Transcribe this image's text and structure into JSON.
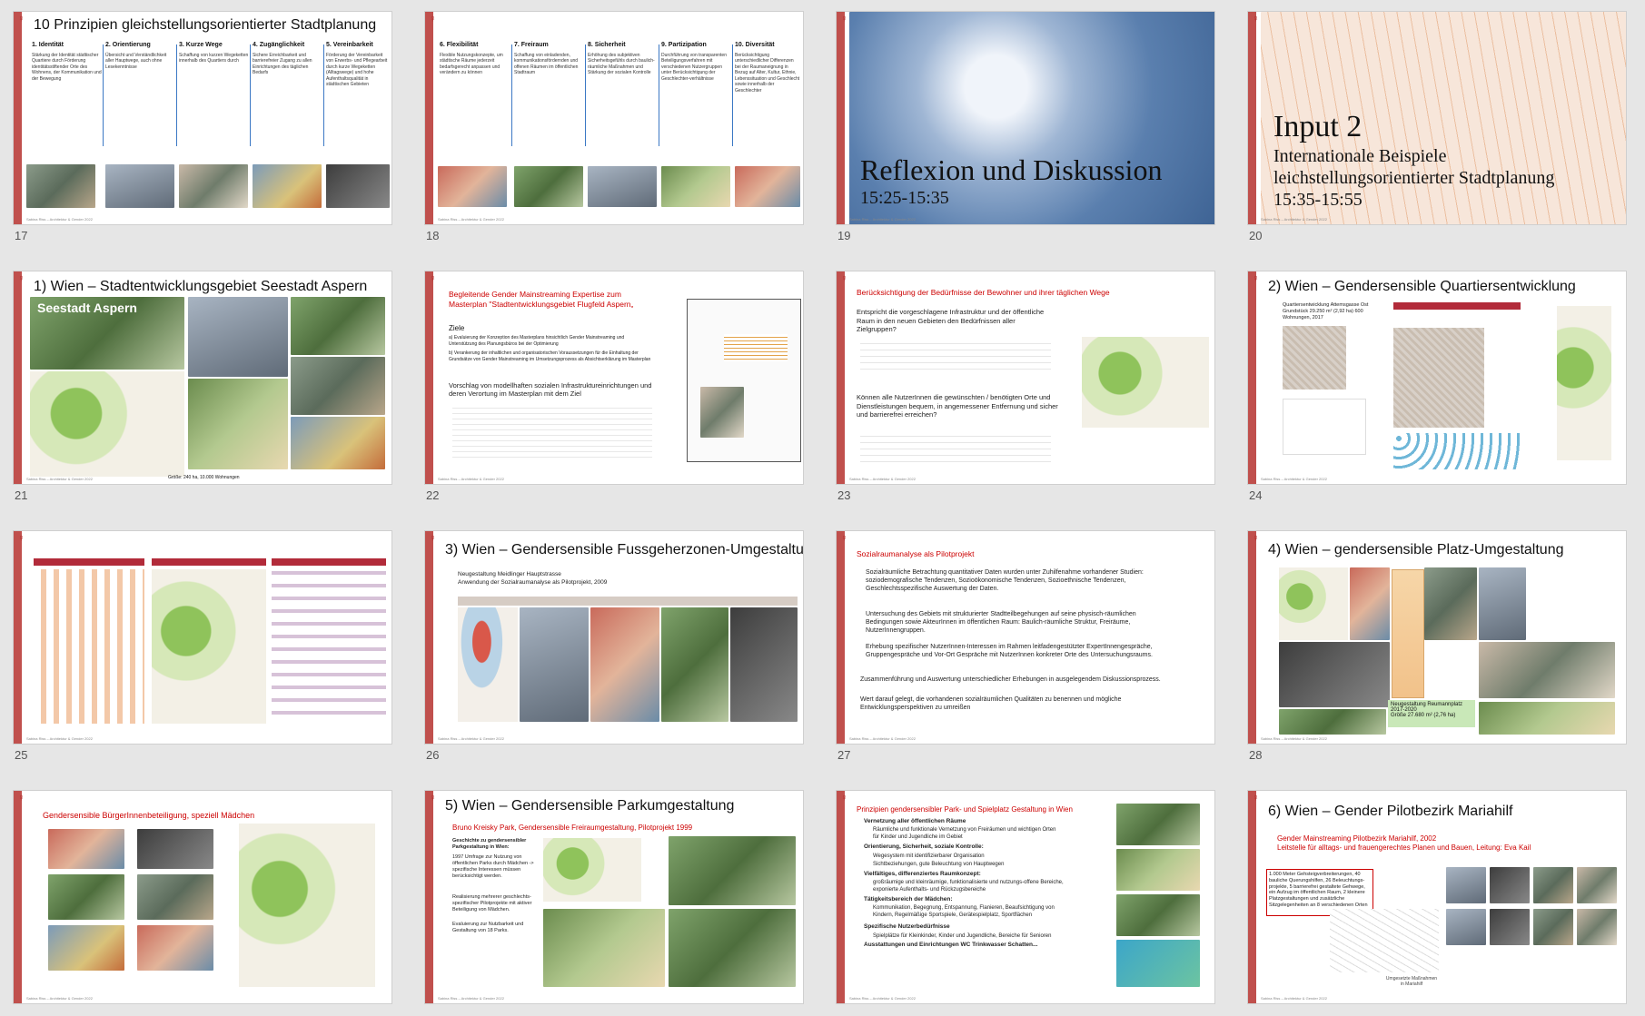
{
  "slides": [
    {
      "num": "17",
      "title": "10 Prinzipien gleichstellungsorientierter Stadtplanung",
      "cols": [
        {
          "head": "1. Identität",
          "text": "Stärkung der Identität städtischer Quartiere durch Förderung identitätsstiftender Orte des Wohnens, der Kommunikation und der Bewegung"
        },
        {
          "head": "2. Orientierung",
          "text": "Übersicht und Verständlichkeit aller Hauptwege, auch ohne Lesekenntnisse"
        },
        {
          "head": "3. Kurze Wege",
          "text": "Schaffung von kurzen Wegeketten innerhalb des Quartiers durch"
        },
        {
          "head": "4. Zugänglichkeit",
          "text": "Sichere Erreichbarkeit und barrierefreier Zugang zu allen Einrichtungen des täglichen Bedarfs"
        },
        {
          "head": "5. Vereinbarkeit",
          "text": "Förderung der Vereinbarkeit von Erwerbs- und Pflegearbeit durch kurze Wegeketten (Alltagswege) und hohe Aufenthaltsqualität in städtischen Gebieten"
        }
      ]
    },
    {
      "num": "18",
      "cols": [
        {
          "head": "6. Flexibilität",
          "text": "Flexible Nutzungskonzepte, um städtische Räume jederzeit bedarfsgerecht anpassen und verändern zu können"
        },
        {
          "head": "7. Freiraum",
          "text": "Schaffung von einladenden, kommunikationsfördernden und offenen Räumen im öffentlichen Stadtraum"
        },
        {
          "head": "8. Sicherheit",
          "text": "Erhöhung des subjektiven Sicherheitsgefühls durch baulich-räumliche Maßnahmen und Stärkung der sozialen Kontrolle"
        },
        {
          "head": "9. Partizipation",
          "text": "Durchführung von transparenten Beteiligungsverfahren mit verschiedenen Nutzergruppen unter Berücksichtigung der Geschlechter-verhältnisse"
        },
        {
          "head": "10. Diversität",
          "text": "Berücksichtigung unterschiedlicher Differenzen bei der Raumaneignung in Bezug auf Alter, Kultur, Ethnie, Lebenssituation und Geschlecht sowie innerhalb der Geschlechter"
        }
      ]
    },
    {
      "num": "19",
      "title": "Reflexion und Diskussion",
      "sub": "15:25-15:35"
    },
    {
      "num": "20",
      "title": "Input 2",
      "l1": "Internationale Beispiele",
      "l2": "leichstellungsorientierter Stadtplanung",
      "l3": "15:35-15:55"
    },
    {
      "num": "21",
      "title": "1) Wien – Stadtentwicklungsgebiet Seestadt Aspern",
      "overlay": "Seestadt Aspern",
      "caption": "Größe: 240 ha, 10.000 Wohnungen"
    },
    {
      "num": "22",
      "title": "Begleitende Gender Mainstreaming Expertise zum Masterplan \"Stadtentwicklungsgebiet Flugfeld Aspern„",
      "ziele": "Ziele",
      "a": "Evaluierung der Konzeption des Masterplans hinsichtlich Gender Mainstreaming und Unterstützung des Planungsbüros bei der Optimierung",
      "b": "Verankerung der inhaltlichen und organisatorischen Voraussetzungen für die Einhaltung der Grundsätze von Gender Mainstreaming im Umsetzungsprozess als Absichtserklärung im Masterplan",
      "vorschlag": "Vorschlag von modellhaften sozialen Infrastruktureinrichtungen und deren Verortung im Masterplan mit dem Ziel"
    },
    {
      "num": "23",
      "title": "Berücksichtigung der Bedürfnisse der Bewohner und ihrer täglichen Wege",
      "t1": "Entspricht die vorgeschlagene Infrastruktur und der öffentliche Raum in den neuen Gebieten den Bedürfnissen aller Zielgruppen?",
      "t2": "Können alle NutzerInnen die gewünschten / benötigten Orte und Dienstleistungen bequem, in angemessener Entfernung und sicher und barrierefrei erreichen?"
    },
    {
      "num": "24",
      "title": "2) Wien – Gendersensible Quartiersentwicklung",
      "info": "Quartiersentwicklung Attemsgasse Ost Grundstück 29.250 m² (2,92 ha) 600 Wohnungen, 2017"
    },
    {
      "num": "25"
    },
    {
      "num": "26",
      "title": "3) Wien – Gendersensible Fussgeherzonen-Umgestaltung",
      "sub1": "Neugestaltung Meidlinger Hauptstrasse",
      "sub2": "Anwendung der Sozialraumanalyse als Pilotprojekt, 2009"
    },
    {
      "num": "27",
      "title": "Sozialraumanalyse als Pilotprojekt",
      "b1": "Sozialräumliche Betrachtung quantitativer Daten wurden unter Zuhilfenahme vorhandener Studien: soziodemografische Tendenzen, Sozioökonomische Tendenzen, Sozioethnische Tendenzen, Geschlechtsspezifische Auswertung der Daten.",
      "b2": "Untersuchung des Gebiets mit strukturierter Stadtteilbegehungen auf seine physisch-räumlichen Bedingungen sowie AkteurInnen im öffentlichen Raum: Baulich-räumliche Struktur, Freiräume, NutzerInnengruppen.",
      "b3": "Erhebung spezifischer NutzerInnen-Interessen im Rahmen leitfadengestützter ExpertInnengespräche, Gruppengespräche und Vor-Ort Gespräche mit NutzerInnen konkreter Orte des Untersuchungsraums.",
      "p1": "Zusammenführung und Auswertung unterschiedlicher Erhebungen in ausgelegendem Diskussionsprozess.",
      "p2": "Wert darauf gelegt, die vorhandenen sozialräumlichen Qualitäten zu benennen und mögliche Entwicklungsperspektiven zu umreißen"
    },
    {
      "num": "28",
      "title": "4) Wien – gendersensible Platz-Umgestaltung",
      "cap1": "Neugestaltung Reumannplatz",
      "cap2": "2017-2020",
      "cap3": "Größe 27.680 m² (2,76 ha)"
    },
    {
      "num": "29",
      "title": "Gendersensible BürgerInnenbeteiligung, speziell Mädchen"
    },
    {
      "num": "30",
      "title": "5) Wien – Gendersensible Parkumgestaltung",
      "red": "Bruno Kreisky Park, Gendersensible Freiraumgestaltung, Pilotprojekt 1999",
      "t1": "Geschichte zu gendersensibler Parkgestaltung in Wien:",
      "t2": "1997 Umfrage zur Nutzung von öffentlichen Parks durch Mädchen -> spezifische Interessen müssen berücksichtigt werden.",
      "t3": "Realisierung mehrerer geschlechts-spezifischer Pilotprojekte mit aktiver Beteiligung von Mädchen.",
      "t4": "Evaluierung zur Nutzbarkeit und Gestaltung von 18 Parks."
    },
    {
      "num": "31",
      "title": "Prinzipien gendersensibler Park- und Spielplatz Gestaltung in Wien",
      "h1": "Vernetzung aller öffentlichen Räume",
      "i1": "Räumliche und funktionale Vernetzung von Freiräumen und wichtigen Orten für Kinder und Jugendliche im Gebiet",
      "h2": "Orientierung, Sicherheit, soziale Kontrolle:",
      "i2": "Wegesystem mit identifizierbarer Organisation",
      "i3": "Sichtbeziehungen, gute Beleuchtung von Hauptwegen",
      "h3": "Vielfältiges, differenziertes Raumkonzept:",
      "i4": "großräumige und kleinräumige, funktionalisierte und nutzungs-offene Bereiche, exponierte Aufenthalts- und Rückzugsbereiche",
      "h4": "Tätigkeitsbereich der Mädchen:",
      "i5": "Kommunikation, Begegnung, Entspannung, Flanieren, Beaufsichtigung von Kindern, Regelmäßige Sportspiele, Gerätespielplatz, Sportflächen",
      "h5": "Spezifische Nutzerbedürfnisse",
      "i6": "Spielplätze für Kleinkinder, Kinder und Jugendliche, Bereiche für Senioren",
      "h6": "Ausstattungen und Einrichtungen WC Trinkwasser Schatten..."
    },
    {
      "num": "32",
      "title": "6) Wien – Gender Pilotbezirk Mariahilf",
      "red1": "Gender Mainstreaming Pilotbezirk Mariahilf, 2002",
      "red2": "Leitstelle für alltags- und frauengerechtes Planen und Bauen, Leitung: Eva Kail",
      "box": "1.000 Meter Gehsteigverbreiterungen, 40 bauliche Querungshilfen, 26 Beleuchtungs-projekte, 5 barrierefrei gestaltete Gehwege, ein Aufzug im öffentlichen Raum, 2 kleinere Platzgestaltungen und zusätzliche Sitzgelegenheiten an 8 verschiedenen Orten",
      "caption": "Umgesetzte Maßnahmen in Mariahilf"
    }
  ],
  "footer": "Sabina Riss – Architektur & Gender 2022",
  "colors": {
    "accent": "#c0504d",
    "titleRed": "#cc0000",
    "blue": "#3b78c4"
  }
}
